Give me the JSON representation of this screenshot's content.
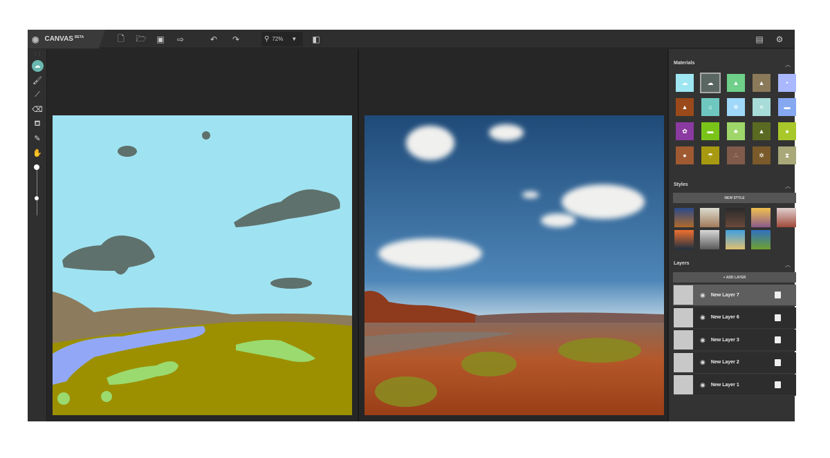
{
  "app": {
    "name": "CANVAS",
    "badge": "BETA",
    "zoom": "72%"
  },
  "toolbar": {
    "icons": [
      "new-file-icon",
      "open-folder-icon",
      "save-icon",
      "export-icon",
      "undo-icon",
      "redo-icon",
      "zoom-icon",
      "compare-view-icon",
      "feedback-icon",
      "settings-icon"
    ]
  },
  "left_tools": [
    "material-brush",
    "brush",
    "line",
    "eraser",
    "fill",
    "eyedropper",
    "pan"
  ],
  "panel": {
    "materials_title": "Materials",
    "materials": [
      {
        "name": "sky",
        "color": "#9ee6f2"
      },
      {
        "name": "cloud",
        "color": "#5a6662"
      },
      {
        "name": "grass",
        "color": "#6fd08a"
      },
      {
        "name": "mountain",
        "color": "#8a7a5a"
      },
      {
        "name": "snow",
        "color": "#a9b8ff"
      },
      {
        "name": "rock",
        "color": "#9a4a1a"
      },
      {
        "name": "house",
        "color": "#6fc8c0"
      },
      {
        "name": "ice",
        "color": "#9fd8f8"
      },
      {
        "name": "fog",
        "color": "#a7dcd8"
      },
      {
        "name": "water",
        "color": "#86a8f0"
      },
      {
        "name": "flower",
        "color": "#8a3aa0"
      },
      {
        "name": "bush",
        "color": "#7ac41a"
      },
      {
        "name": "plant",
        "color": "#9ed66a"
      },
      {
        "name": "hill",
        "color": "#5a6a22"
      },
      {
        "name": "tree",
        "color": "#a8c82a"
      },
      {
        "name": "stone",
        "color": "#a05a32"
      },
      {
        "name": "sand-beach",
        "color": "#a89a10"
      },
      {
        "name": "dirt",
        "color": "#805a4a"
      },
      {
        "name": "gravel",
        "color": "#7a5a2a"
      },
      {
        "name": "desert",
        "color": "#a8a878"
      }
    ],
    "styles_title": "Styles",
    "new_style": "NEW STYLE",
    "styles": [
      [
        "#2a4a8a",
        "#b06a2a"
      ],
      [
        "#dcdcd0",
        "#a07a5a"
      ],
      [
        "#2a2a2a",
        "#6a4a3a"
      ],
      [
        "#f0c050",
        "#8a5a8a"
      ],
      [
        "#e0d0d0",
        "#a04a3a"
      ],
      [
        "#f07030",
        "#203040"
      ],
      [
        "#d8d8d8",
        "#5a5a5a"
      ],
      [
        "#40a0e0",
        "#e0c070"
      ],
      [
        "#3070c0",
        "#70a030"
      ]
    ],
    "layers_title": "Layers",
    "add_layer": "+ ADD LAYER",
    "layers": [
      {
        "name": "New Layer 7",
        "selected": true
      },
      {
        "name": "New Layer 6"
      },
      {
        "name": "New Layer 3"
      },
      {
        "name": "New Layer 2"
      },
      {
        "name": "New Layer 1"
      }
    ]
  },
  "colors": {
    "sky": "#9fe3f2",
    "cloud": "#5f716c",
    "hill": "#8c7b5c",
    "ground": "#9c9000",
    "water": "#92a8f6",
    "grass": "#9ada6e"
  }
}
